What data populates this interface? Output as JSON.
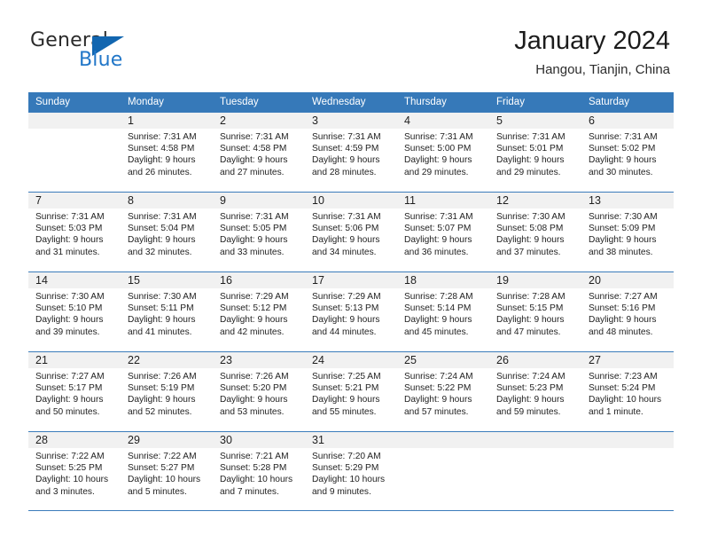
{
  "brand": {
    "name_top": "General",
    "name_bottom": "Blue",
    "accent_color": "#2277c8",
    "triangle_color": "#1266b0"
  },
  "header": {
    "title": "January 2024",
    "subtitle": "Hangou, Tianjin, China"
  },
  "calendar": {
    "header_bg": "#3679b9",
    "weekdays": [
      "Sunday",
      "Monday",
      "Tuesday",
      "Wednesday",
      "Thursday",
      "Friday",
      "Saturday"
    ],
    "weeks": [
      [
        {
          "day": "",
          "sunrise": "",
          "sunset": "",
          "daylight_1": "",
          "daylight_2": ""
        },
        {
          "day": "1",
          "sunrise": "Sunrise: 7:31 AM",
          "sunset": "Sunset: 4:58 PM",
          "daylight_1": "Daylight: 9 hours",
          "daylight_2": "and 26 minutes."
        },
        {
          "day": "2",
          "sunrise": "Sunrise: 7:31 AM",
          "sunset": "Sunset: 4:58 PM",
          "daylight_1": "Daylight: 9 hours",
          "daylight_2": "and 27 minutes."
        },
        {
          "day": "3",
          "sunrise": "Sunrise: 7:31 AM",
          "sunset": "Sunset: 4:59 PM",
          "daylight_1": "Daylight: 9 hours",
          "daylight_2": "and 28 minutes."
        },
        {
          "day": "4",
          "sunrise": "Sunrise: 7:31 AM",
          "sunset": "Sunset: 5:00 PM",
          "daylight_1": "Daylight: 9 hours",
          "daylight_2": "and 29 minutes."
        },
        {
          "day": "5",
          "sunrise": "Sunrise: 7:31 AM",
          "sunset": "Sunset: 5:01 PM",
          "daylight_1": "Daylight: 9 hours",
          "daylight_2": "and 29 minutes."
        },
        {
          "day": "6",
          "sunrise": "Sunrise: 7:31 AM",
          "sunset": "Sunset: 5:02 PM",
          "daylight_1": "Daylight: 9 hours",
          "daylight_2": "and 30 minutes."
        }
      ],
      [
        {
          "day": "7",
          "sunrise": "Sunrise: 7:31 AM",
          "sunset": "Sunset: 5:03 PM",
          "daylight_1": "Daylight: 9 hours",
          "daylight_2": "and 31 minutes."
        },
        {
          "day": "8",
          "sunrise": "Sunrise: 7:31 AM",
          "sunset": "Sunset: 5:04 PM",
          "daylight_1": "Daylight: 9 hours",
          "daylight_2": "and 32 minutes."
        },
        {
          "day": "9",
          "sunrise": "Sunrise: 7:31 AM",
          "sunset": "Sunset: 5:05 PM",
          "daylight_1": "Daylight: 9 hours",
          "daylight_2": "and 33 minutes."
        },
        {
          "day": "10",
          "sunrise": "Sunrise: 7:31 AM",
          "sunset": "Sunset: 5:06 PM",
          "daylight_1": "Daylight: 9 hours",
          "daylight_2": "and 34 minutes."
        },
        {
          "day": "11",
          "sunrise": "Sunrise: 7:31 AM",
          "sunset": "Sunset: 5:07 PM",
          "daylight_1": "Daylight: 9 hours",
          "daylight_2": "and 36 minutes."
        },
        {
          "day": "12",
          "sunrise": "Sunrise: 7:30 AM",
          "sunset": "Sunset: 5:08 PM",
          "daylight_1": "Daylight: 9 hours",
          "daylight_2": "and 37 minutes."
        },
        {
          "day": "13",
          "sunrise": "Sunrise: 7:30 AM",
          "sunset": "Sunset: 5:09 PM",
          "daylight_1": "Daylight: 9 hours",
          "daylight_2": "and 38 minutes."
        }
      ],
      [
        {
          "day": "14",
          "sunrise": "Sunrise: 7:30 AM",
          "sunset": "Sunset: 5:10 PM",
          "daylight_1": "Daylight: 9 hours",
          "daylight_2": "and 39 minutes."
        },
        {
          "day": "15",
          "sunrise": "Sunrise: 7:30 AM",
          "sunset": "Sunset: 5:11 PM",
          "daylight_1": "Daylight: 9 hours",
          "daylight_2": "and 41 minutes."
        },
        {
          "day": "16",
          "sunrise": "Sunrise: 7:29 AM",
          "sunset": "Sunset: 5:12 PM",
          "daylight_1": "Daylight: 9 hours",
          "daylight_2": "and 42 minutes."
        },
        {
          "day": "17",
          "sunrise": "Sunrise: 7:29 AM",
          "sunset": "Sunset: 5:13 PM",
          "daylight_1": "Daylight: 9 hours",
          "daylight_2": "and 44 minutes."
        },
        {
          "day": "18",
          "sunrise": "Sunrise: 7:28 AM",
          "sunset": "Sunset: 5:14 PM",
          "daylight_1": "Daylight: 9 hours",
          "daylight_2": "and 45 minutes."
        },
        {
          "day": "19",
          "sunrise": "Sunrise: 7:28 AM",
          "sunset": "Sunset: 5:15 PM",
          "daylight_1": "Daylight: 9 hours",
          "daylight_2": "and 47 minutes."
        },
        {
          "day": "20",
          "sunrise": "Sunrise: 7:27 AM",
          "sunset": "Sunset: 5:16 PM",
          "daylight_1": "Daylight: 9 hours",
          "daylight_2": "and 48 minutes."
        }
      ],
      [
        {
          "day": "21",
          "sunrise": "Sunrise: 7:27 AM",
          "sunset": "Sunset: 5:17 PM",
          "daylight_1": "Daylight: 9 hours",
          "daylight_2": "and 50 minutes."
        },
        {
          "day": "22",
          "sunrise": "Sunrise: 7:26 AM",
          "sunset": "Sunset: 5:19 PM",
          "daylight_1": "Daylight: 9 hours",
          "daylight_2": "and 52 minutes."
        },
        {
          "day": "23",
          "sunrise": "Sunrise: 7:26 AM",
          "sunset": "Sunset: 5:20 PM",
          "daylight_1": "Daylight: 9 hours",
          "daylight_2": "and 53 minutes."
        },
        {
          "day": "24",
          "sunrise": "Sunrise: 7:25 AM",
          "sunset": "Sunset: 5:21 PM",
          "daylight_1": "Daylight: 9 hours",
          "daylight_2": "and 55 minutes."
        },
        {
          "day": "25",
          "sunrise": "Sunrise: 7:24 AM",
          "sunset": "Sunset: 5:22 PM",
          "daylight_1": "Daylight: 9 hours",
          "daylight_2": "and 57 minutes."
        },
        {
          "day": "26",
          "sunrise": "Sunrise: 7:24 AM",
          "sunset": "Sunset: 5:23 PM",
          "daylight_1": "Daylight: 9 hours",
          "daylight_2": "and 59 minutes."
        },
        {
          "day": "27",
          "sunrise": "Sunrise: 7:23 AM",
          "sunset": "Sunset: 5:24 PM",
          "daylight_1": "Daylight: 10 hours",
          "daylight_2": "and 1 minute."
        }
      ],
      [
        {
          "day": "28",
          "sunrise": "Sunrise: 7:22 AM",
          "sunset": "Sunset: 5:25 PM",
          "daylight_1": "Daylight: 10 hours",
          "daylight_2": "and 3 minutes."
        },
        {
          "day": "29",
          "sunrise": "Sunrise: 7:22 AM",
          "sunset": "Sunset: 5:27 PM",
          "daylight_1": "Daylight: 10 hours",
          "daylight_2": "and 5 minutes."
        },
        {
          "day": "30",
          "sunrise": "Sunrise: 7:21 AM",
          "sunset": "Sunset: 5:28 PM",
          "daylight_1": "Daylight: 10 hours",
          "daylight_2": "and 7 minutes."
        },
        {
          "day": "31",
          "sunrise": "Sunrise: 7:20 AM",
          "sunset": "Sunset: 5:29 PM",
          "daylight_1": "Daylight: 10 hours",
          "daylight_2": "and 9 minutes."
        },
        {
          "day": "",
          "sunrise": "",
          "sunset": "",
          "daylight_1": "",
          "daylight_2": ""
        },
        {
          "day": "",
          "sunrise": "",
          "sunset": "",
          "daylight_1": "",
          "daylight_2": ""
        },
        {
          "day": "",
          "sunrise": "",
          "sunset": "",
          "daylight_1": "",
          "daylight_2": ""
        }
      ]
    ]
  }
}
